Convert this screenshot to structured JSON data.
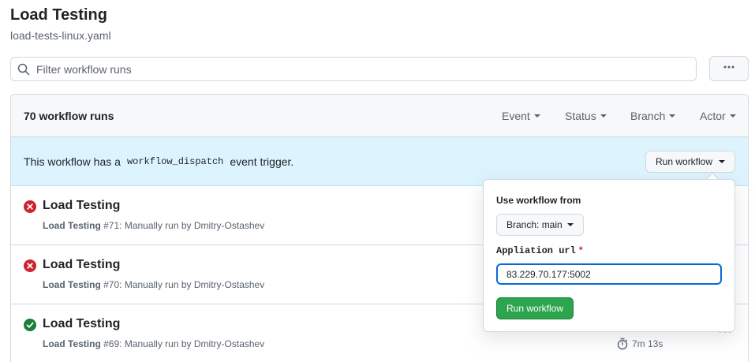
{
  "header": {
    "title": "Load Testing",
    "subtitle": "load-tests-linux.yaml"
  },
  "filter": {
    "placeholder": "Filter workflow runs",
    "icon": "search-icon"
  },
  "more_menu": {
    "icon": "kebab-horizontal-icon",
    "label": "···"
  },
  "runs": {
    "count_label": "70 workflow runs",
    "filters": [
      {
        "label": "Event"
      },
      {
        "label": "Status"
      },
      {
        "label": "Branch"
      },
      {
        "label": "Actor"
      }
    ],
    "dispatch": {
      "text_before": "This workflow has a",
      "code": "workflow_dispatch",
      "text_after": "event trigger.",
      "button_label": "Run workflow"
    },
    "items": [
      {
        "title": "Load Testing",
        "workflow": "Load Testing",
        "number": "#71",
        "description": ": Manually run by Dmitry-Ostashev",
        "status": "failure",
        "status_icon": "x-circle-icon",
        "status_color": "#cf222e"
      },
      {
        "title": "Load Testing",
        "workflow": "Load Testing",
        "number": "#70",
        "description": ": Manually run by Dmitry-Ostashev",
        "status": "failure",
        "status_icon": "x-circle-icon",
        "status_color": "#cf222e"
      },
      {
        "title": "Load Testing",
        "workflow": "Load Testing",
        "number": "#69",
        "description": ": Manually run by Dmitry-Ostashev",
        "status": "success",
        "status_icon": "check-circle-icon",
        "status_color": "#1a7f37",
        "duration": "7m 13s",
        "kebab": "···"
      }
    ]
  },
  "popover": {
    "heading": "Use workflow from",
    "branch_label": "Branch: main",
    "field_label": "Appliation url",
    "required_mark": "*",
    "field_value": "83.229.70.177:5002",
    "submit_label": "Run workflow"
  },
  "colors": {
    "banner_bg": "#ddf4ff",
    "primary_button": "#2da44e",
    "failure": "#cf222e",
    "success": "#1a7f37",
    "focus": "#0969da"
  }
}
